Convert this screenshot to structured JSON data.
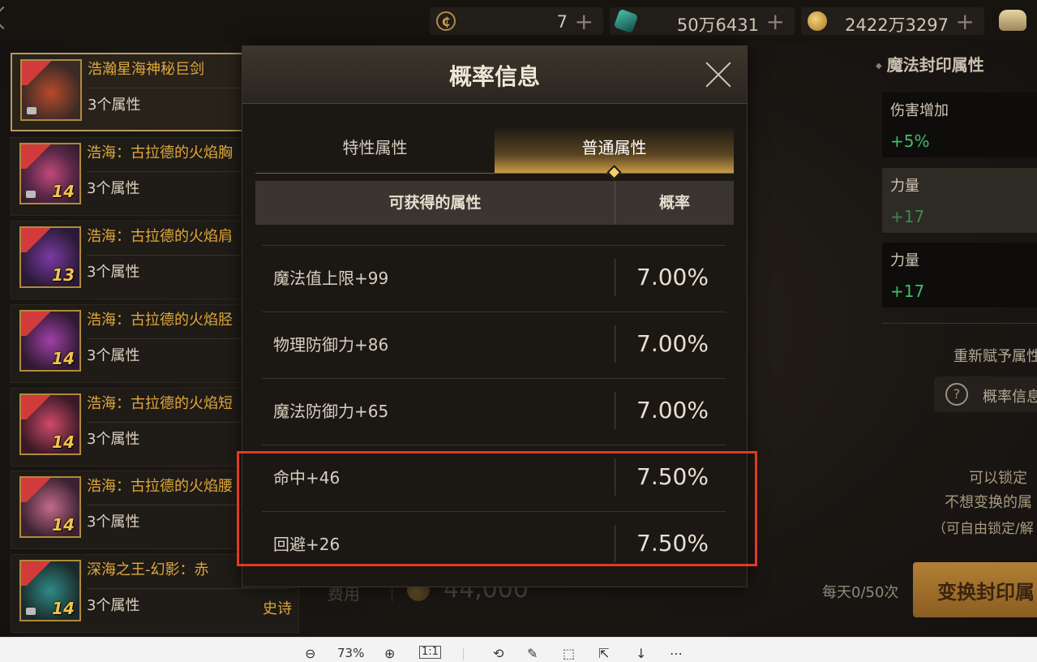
{
  "currencies": [
    {
      "icon": "coupon-coin-icon",
      "value": "7"
    },
    {
      "icon": "gem-icon",
      "value": "50万6431"
    },
    {
      "icon": "gold-coin-icon",
      "value": "2422万3297"
    }
  ],
  "items": [
    {
      "name": "浩瀚星海神秘巨剑",
      "props": "3个属性",
      "level": "",
      "rarity": ""
    },
    {
      "name": "浩海：古拉德的火焰胸",
      "props": "3个属性",
      "level": "14",
      "rarity": ""
    },
    {
      "name": "浩海：古拉德的火焰肩",
      "props": "3个属性",
      "level": "13",
      "rarity": ""
    },
    {
      "name": "浩海：古拉德的火焰胫",
      "props": "3个属性",
      "level": "14",
      "rarity": ""
    },
    {
      "name": "浩海：古拉德的火焰短",
      "props": "3个属性",
      "level": "14",
      "rarity": ""
    },
    {
      "name": "浩海：古拉德的火焰腰",
      "props": "3个属性",
      "level": "14",
      "rarity": ""
    },
    {
      "name": "深海之王-幻影：赤",
      "props": "3个属性",
      "level": "14",
      "rarity": "史诗"
    }
  ],
  "modal": {
    "title": "概率信息",
    "tabs": [
      "特性属性",
      "普通属性"
    ],
    "active_tab": "普通属性",
    "header_attr": "可获得的属性",
    "header_prob": "概率",
    "rows": [
      {
        "attr": "魔法值上限+99",
        "prob": "7.00%"
      },
      {
        "attr": "物理防御力+86",
        "prob": "7.00%"
      },
      {
        "attr": "魔法防御力+65",
        "prob": "7.00%"
      },
      {
        "attr": "命中+46",
        "prob": "7.50%"
      },
      {
        "attr": "回避+26",
        "prob": "7.50%"
      }
    ]
  },
  "right_panel": {
    "title": "魔法封印属性",
    "cards": [
      {
        "name": "伤害增加",
        "value": "+5%"
      },
      {
        "name": "力量",
        "value": "+17"
      },
      {
        "name": "力量",
        "value": "+17"
      }
    ],
    "reassign": "重新赋予属性",
    "prob_button": "概率信息",
    "note1": "可以锁定",
    "note2": "不想变换的属",
    "note3": "（可自由锁定/解"
  },
  "footer": {
    "cost_label": "费用",
    "cost_value": "44,000",
    "daily": "每天0/50次",
    "transform_button": "变换封印属"
  },
  "viewer": {
    "zoom": "73%",
    "actual_size": "1:1"
  }
}
